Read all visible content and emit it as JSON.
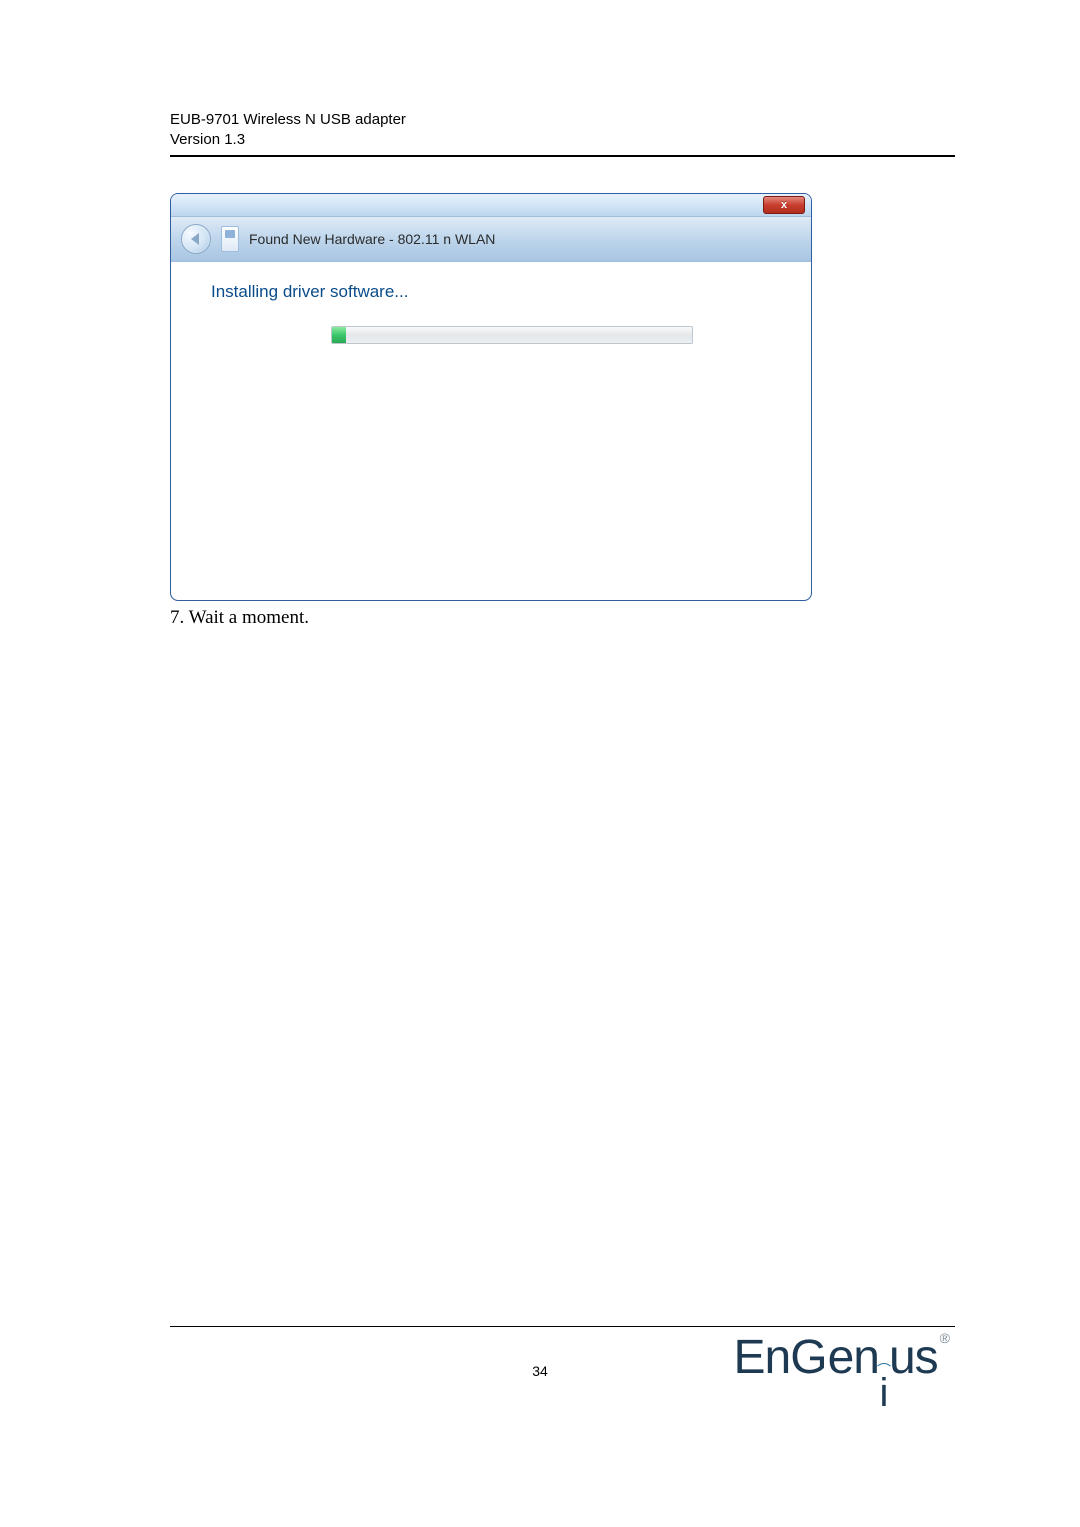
{
  "header": {
    "line1": "EUB-9701 Wireless N USB adapter",
    "line2": "Version 1.3"
  },
  "dialog": {
    "close_glyph": "x",
    "breadcrumb": "Found New Hardware - 802.11 n WLAN",
    "instruction": "Installing driver software..."
  },
  "caption": "7. Wait a moment.",
  "page_number": "34",
  "logo": {
    "part1": "En",
    "part2": "G",
    "part3": "en",
    "wifi_glyph": "⌒",
    "i_letter": "i",
    "part4": "us",
    "reg": "®"
  }
}
